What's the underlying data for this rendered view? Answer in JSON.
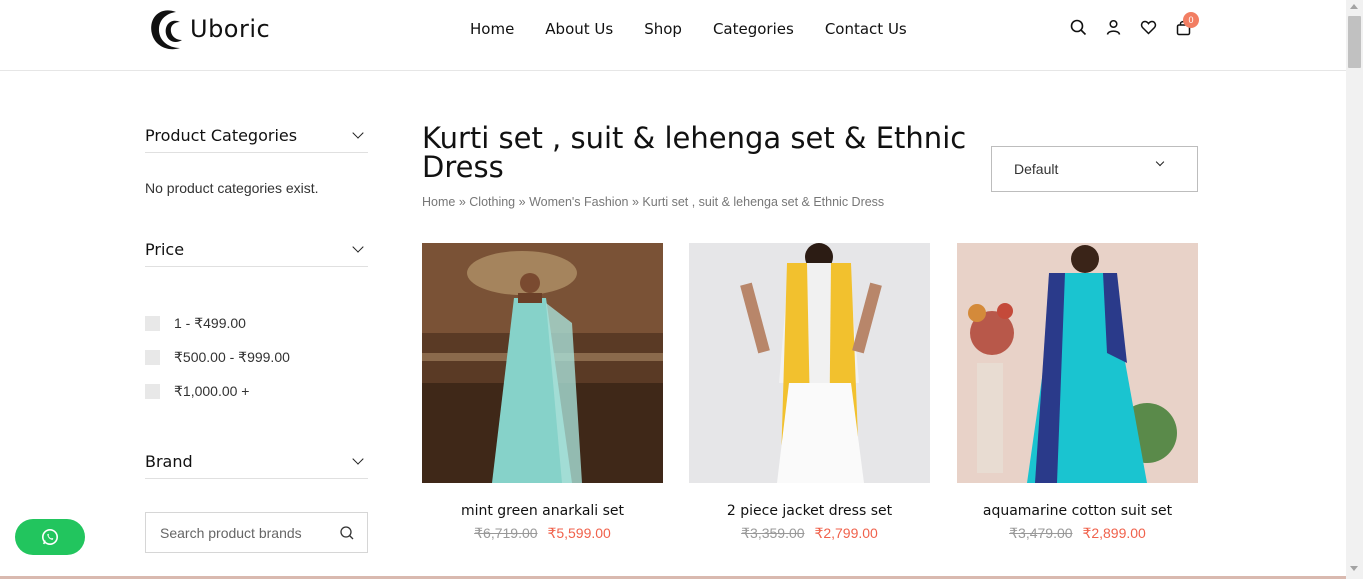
{
  "header": {
    "logo_text": "Uboric",
    "nav": [
      "Home",
      "About Us",
      "Shop",
      "Categories",
      "Contact Us"
    ],
    "cart_count": "0"
  },
  "sidebar": {
    "categories_title": "Product Categories",
    "categories_empty": "No product categories exist.",
    "price_title": "Price",
    "price_ranges": [
      "1 - ₹499.00",
      "₹500.00 - ₹999.00",
      "₹1,000.00 +"
    ],
    "brand_title": "Brand",
    "brand_search_placeholder": "Search product brands"
  },
  "main": {
    "title": "Kurti set , suit & lehenga set & Ethnic Dress",
    "breadcrumb": {
      "items": [
        "Home",
        "Clothing",
        "Women's Fashion",
        "Kurti set , suit & lehenga set & Ethnic Dress"
      ],
      "separator": "»"
    },
    "sort_value": "Default",
    "products": [
      {
        "name": "mint green anarkali set",
        "old_price": "₹6,719.00",
        "price": "₹5,599.00"
      },
      {
        "name": "2 piece jacket dress set",
        "old_price": "₹3,359.00",
        "price": "₹2,799.00"
      },
      {
        "name": "aquamarine cotton suit set",
        "old_price": "₹3,479.00",
        "price": "₹2,899.00"
      }
    ]
  },
  "colors": {
    "accent": "#f0624c",
    "badge": "#f27e63",
    "whatsapp": "#22c55e"
  },
  "icons": [
    "search-icon",
    "user-icon",
    "heart-icon",
    "bag-icon",
    "chevron-down-icon",
    "whatsapp-icon"
  ]
}
